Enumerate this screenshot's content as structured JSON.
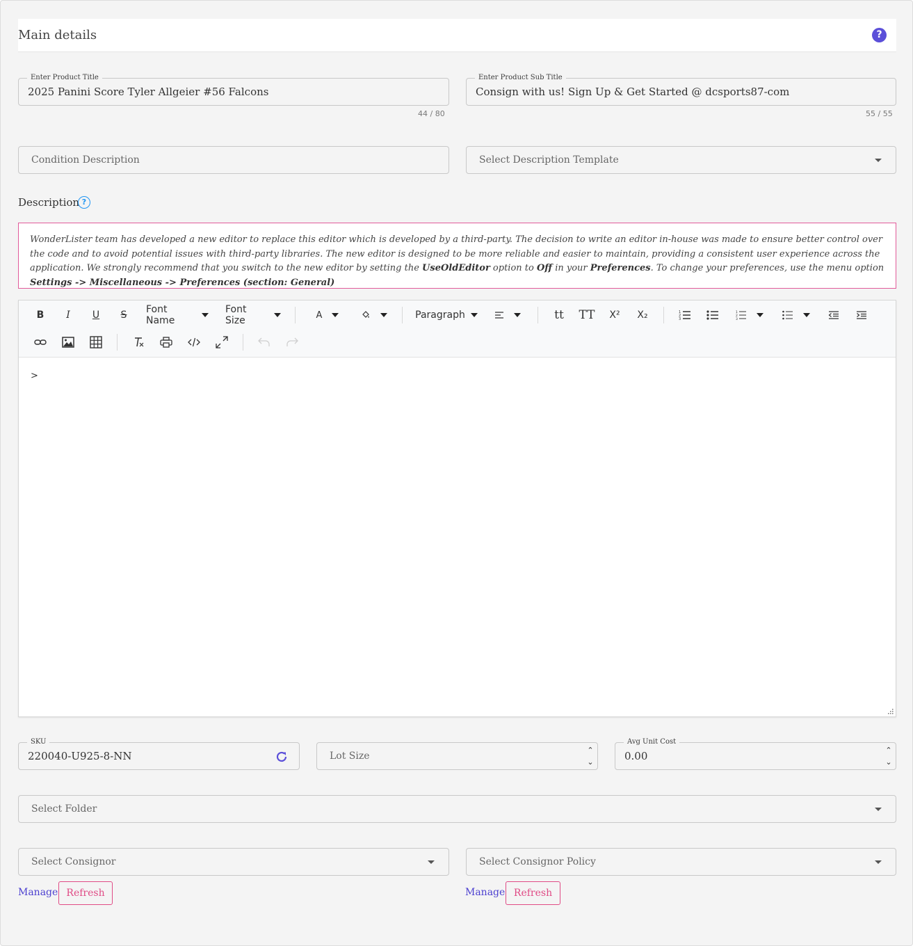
{
  "header": {
    "title": "Main details",
    "help_glyph": "?"
  },
  "product_title": {
    "label": "Enter Product Title",
    "value": "2025 Panini Score Tyler Allgeier #56 Falcons",
    "counter": "44 / 80"
  },
  "product_subtitle": {
    "label": "Enter Product Sub Title",
    "value": "Consign with us! Sign Up & Get Started @ dcsports87-com",
    "counter": "55 / 55"
  },
  "condition_description": {
    "placeholder": "Condition Description"
  },
  "description_template": {
    "placeholder": "Select Description Template"
  },
  "description": {
    "label": "Description",
    "help_glyph": "?",
    "notice": {
      "part1": "WonderLister team has developed a new editor to replace this editor which is developed by a third-party. The decision to write an editor in-house was made to ensure better control over the code and to avoid potential issues with third-party libraries. The new editor is designed to be more reliable and easier to maintain, providing a consistent user experience across the application. We strongly recommend that you switch to the new editor by setting the ",
      "option_name": "UseOldEditor",
      "part2": " option to ",
      "option_value": "Off",
      "part3": " in your ",
      "preferences": "Preferences",
      "part4": ". To change your preferences, use the menu option ",
      "menu_path": "Settings -> Miscellaneous -> Preferences (section: General)"
    }
  },
  "editor": {
    "toolbar": {
      "bold": "B",
      "italic": "I",
      "underline": "U",
      "strike": "S",
      "font_name": "Font Name",
      "font_size": "Font Size",
      "font_color": "A",
      "paragraph": "Paragraph",
      "lower_case": "tt",
      "upper_case": "TT",
      "superscript": "X²",
      "subscript": "X₂"
    },
    "content": ">"
  },
  "sku": {
    "label": "SKU",
    "value": "220040-U925-8-NN"
  },
  "lot_size": {
    "placeholder": "Lot Size"
  },
  "avg_unit_cost": {
    "label": "Avg Unit Cost",
    "value": "0.00"
  },
  "folder": {
    "placeholder": "Select Folder"
  },
  "consignor": {
    "placeholder": "Select Consignor",
    "manage": "Manage",
    "refresh": "Refresh"
  },
  "consignor_policy": {
    "placeholder": "Select Consignor Policy",
    "manage": "Manage",
    "refresh": "Refresh"
  },
  "colors": {
    "accent": "#5b4fd9",
    "notice_border": "#e15a9a",
    "refresh": "#e04a85",
    "info": "#2196f3"
  }
}
